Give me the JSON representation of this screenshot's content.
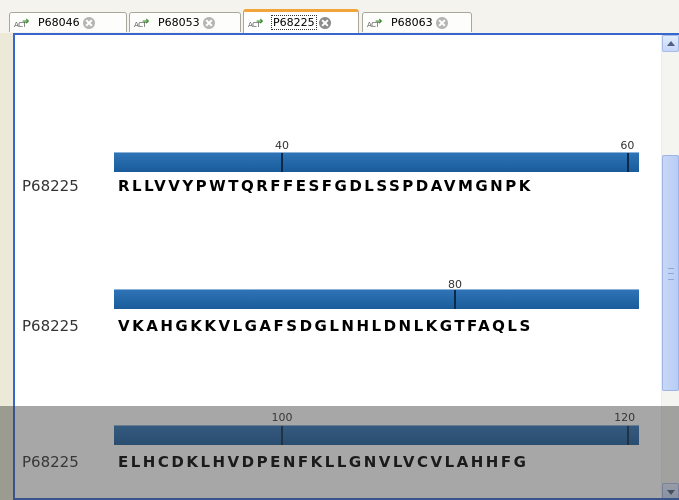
{
  "tabs": [
    {
      "icon_text": "ACT",
      "label": "P68046",
      "active": false
    },
    {
      "icon_text": "ACT",
      "label": "P68053",
      "active": false
    },
    {
      "icon_text": "ACT",
      "label": "P68225",
      "active": true
    },
    {
      "icon_text": "ACT",
      "label": "P68063",
      "active": false
    }
  ],
  "rows": [
    {
      "name": "P68225",
      "sequence": "RLLVVYPWTQRFFESFGDLSSPDAVMGNPK",
      "ticks": [
        "40",
        "60"
      ]
    },
    {
      "name": "P68225",
      "sequence": "VKAHGKKVLGAFSDGLNHLDNLKGTFAQLS",
      "ticks": [
        "80"
      ]
    },
    {
      "name": "P68225",
      "sequence": "ELHCDKLHVDPENFKLLGNVLVCVLAHHFG",
      "ticks": [
        "100",
        "120"
      ]
    }
  ],
  "colors": {
    "ruler": "#1f65a8",
    "tab_active_accent": "#f2a33a",
    "frame_border": "#3866cc"
  },
  "icons": {
    "tab_icon": "act-arrow-icon",
    "tab_close": "close-circle-icon",
    "scroll_up": "scroll-up-arrow-icon",
    "scroll_down": "scroll-down-arrow-icon"
  }
}
